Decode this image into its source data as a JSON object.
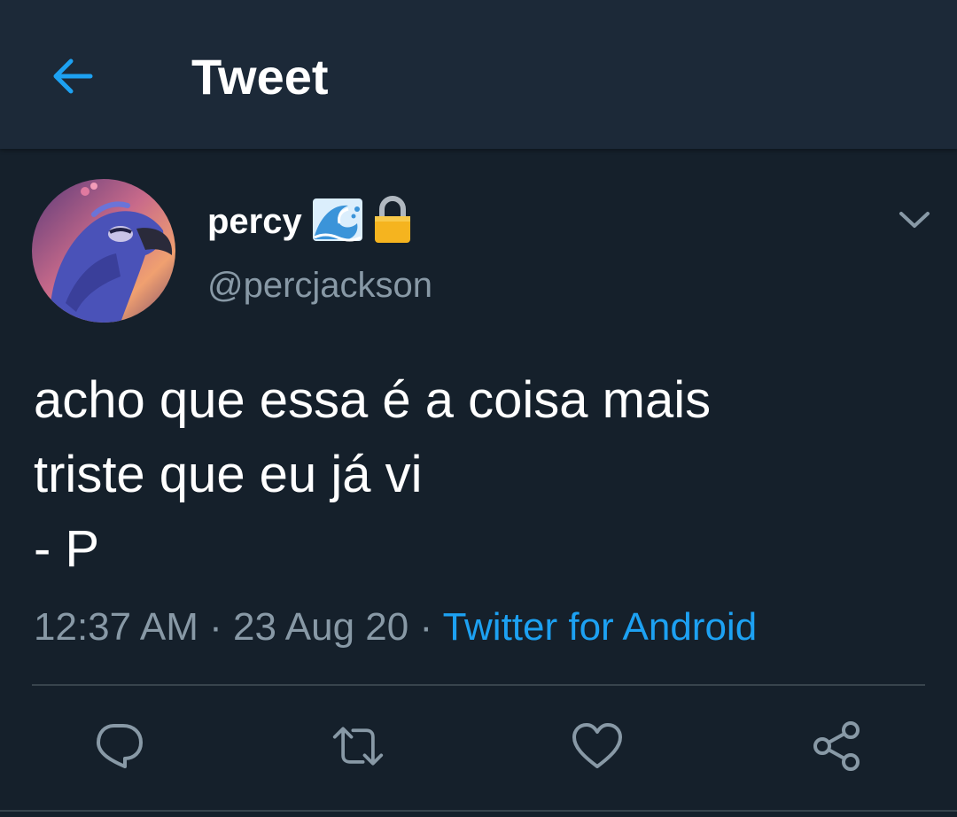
{
  "header": {
    "title": "Tweet",
    "back_icon": "arrow-left-icon"
  },
  "tweet": {
    "display_name": "percy",
    "name_emojis": [
      "wave-emoji",
      "lock-emoji"
    ],
    "handle": "@percjackson",
    "text": "acho que essa é a coisa mais\ntriste que eu já vi\n- P",
    "time": "12:37 AM",
    "date": "23 Aug 20",
    "separator": "·",
    "source": "Twitter for Android"
  },
  "actions": [
    {
      "name": "reply",
      "icon": "reply-icon"
    },
    {
      "name": "retweet",
      "icon": "retweet-icon"
    },
    {
      "name": "like",
      "icon": "heart-icon"
    },
    {
      "name": "share",
      "icon": "share-icon"
    }
  ],
  "colors": {
    "background": "#15202b",
    "header_bg": "#1c2938",
    "accent": "#1da1f2",
    "secondary_text": "#8899a6",
    "divider": "#38444d"
  }
}
